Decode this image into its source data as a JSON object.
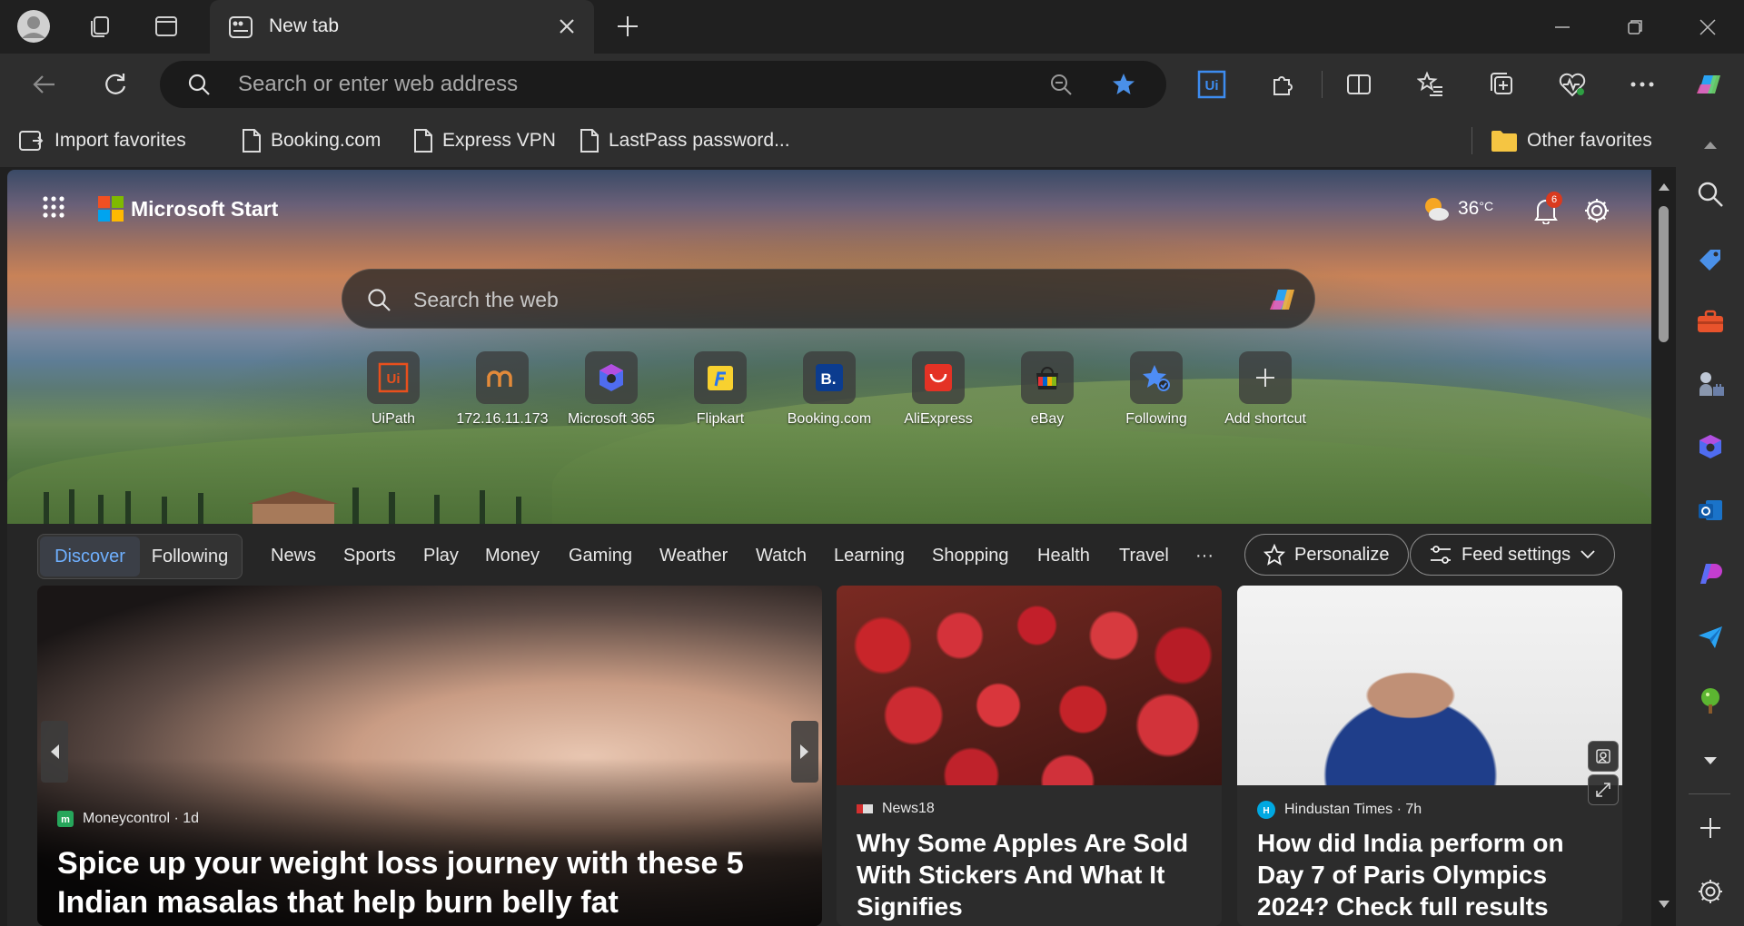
{
  "window": {
    "tab_title": "New tab"
  },
  "toolbar": {
    "address_placeholder": "Search or enter web address"
  },
  "favorites": {
    "items": [
      "Import favorites",
      "Booking.com",
      "Express VPN",
      "LastPass password..."
    ],
    "other": "Other favorites"
  },
  "start": {
    "brand": "Microsoft Start",
    "temperature": "36",
    "temp_unit": "°C",
    "notification_count": "6",
    "search_placeholder": "Search the web",
    "tiles": [
      {
        "label": "UiPath",
        "icon": "uipath-icon",
        "color": "#e8501d"
      },
      {
        "label": "172.16.11.173",
        "icon": "site-icon",
        "color": "#e38a3a"
      },
      {
        "label": "Microsoft 365",
        "icon": "microsoft-365-icon",
        "color": "#4f6cf0"
      },
      {
        "label": "Flipkart",
        "icon": "flipkart-icon",
        "color": "#f8d12f"
      },
      {
        "label": "Booking.com",
        "icon": "booking-icon",
        "color": "#0b3c8f"
      },
      {
        "label": "AliExpress",
        "icon": "aliexpress-icon",
        "color": "#e43225"
      },
      {
        "label": "eBay",
        "icon": "ebay-icon",
        "color": "#333333"
      },
      {
        "label": "Following",
        "icon": "following-icon",
        "color": "#4e8df5"
      },
      {
        "label": "Add shortcut",
        "icon": "plus-icon",
        "color": "#dddddd"
      }
    ]
  },
  "feed": {
    "segments": [
      "Discover",
      "Following"
    ],
    "categories": [
      "News",
      "Sports",
      "Play",
      "Money",
      "Gaming",
      "Weather",
      "Watch",
      "Learning",
      "Shopping",
      "Health",
      "Travel",
      "···"
    ],
    "personalize": "Personalize",
    "feed_settings": "Feed settings",
    "cards": [
      {
        "source": "Moneycontrol · 1d",
        "headline": "Spice up your weight loss journey with these 5 Indian masalas that help burn belly fat"
      },
      {
        "source": "News18",
        "headline": "Why Some Apples Are Sold With Stickers And What It Signifies"
      },
      {
        "source": "Hindustan Times · 7h",
        "headline": "How did India perform on Day 7 of Paris Olympics 2024? Check full results"
      }
    ]
  },
  "colors": {
    "accent_blue": "#6fb0ff",
    "badge_red": "#d93a1f"
  }
}
